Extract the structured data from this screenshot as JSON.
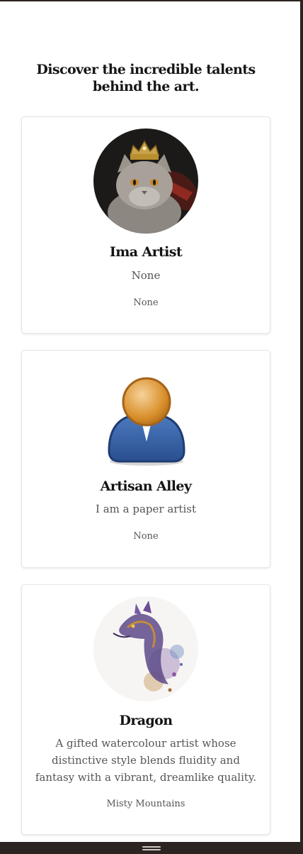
{
  "page": {
    "heading": "Discover the incredible talents behind the art."
  },
  "artists": [
    {
      "name": "Ima Artist",
      "bio": "None",
      "location": "None",
      "avatar_icon": "cat-with-crown-photo"
    },
    {
      "name": "Artisan Alley",
      "bio": "I am a paper artist",
      "location": "None",
      "avatar_icon": "default-user-icon"
    },
    {
      "name": "Dragon",
      "bio": "A gifted watercolour artist whose distinctive style blends fluidity and fantasy with a vibrant, dreamlike quality.",
      "location": "Misty Mountains",
      "avatar_icon": "watercolor-dragon-image"
    }
  ],
  "colors": {
    "frame": "#2b2420",
    "card_border": "#e6e6e6",
    "text": "#1c1c1c",
    "muted": "#555555"
  }
}
